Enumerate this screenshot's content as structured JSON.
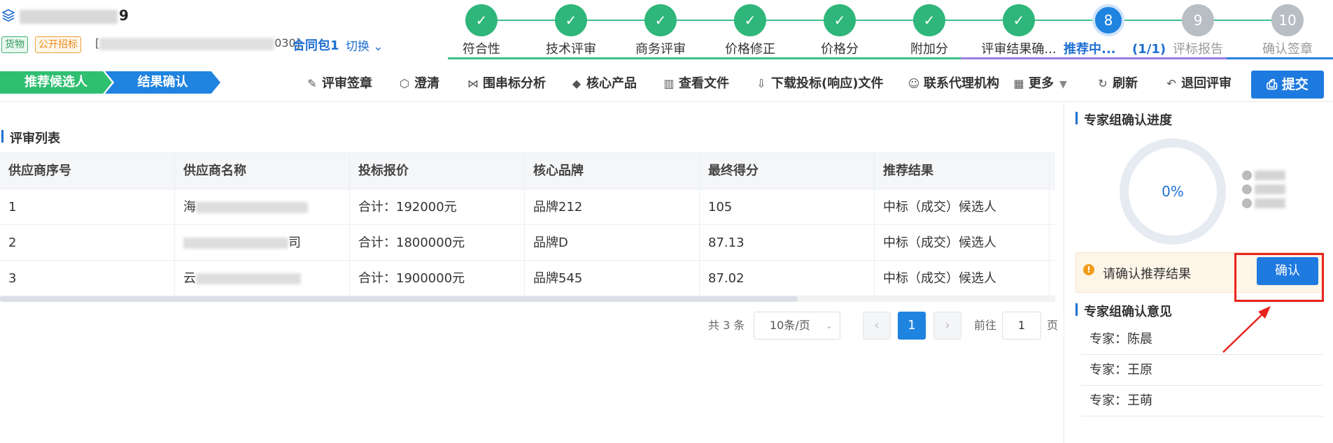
{
  "project": {
    "title_suffix": "9",
    "tag_goods": "货物",
    "tag_public": "公开招标",
    "code_prefix": "[",
    "code_suffix": "030]",
    "package": "合同包1",
    "switch_label": "切换"
  },
  "steps": [
    {
      "num": "✓",
      "label": "符合性",
      "state": "done"
    },
    {
      "num": "✓",
      "label": "技术评审",
      "state": "done"
    },
    {
      "num": "✓",
      "label": "商务评审",
      "state": "done"
    },
    {
      "num": "✓",
      "label": "价格修正",
      "state": "done"
    },
    {
      "num": "✓",
      "label": "价格分",
      "state": "done"
    },
    {
      "num": "✓",
      "label": "附加分",
      "state": "done"
    },
    {
      "num": "✓",
      "label": "评审结果确...",
      "state": "done"
    },
    {
      "num": "8",
      "label": "推荐中...",
      "state": "current",
      "count": "(1/1)"
    },
    {
      "num": "9",
      "label": "评标报告",
      "state": "todo"
    },
    {
      "num": "10",
      "label": "确认签章",
      "state": "todo"
    }
  ],
  "subflow": {
    "step1": "推荐候选人",
    "step2": "结果确认"
  },
  "toolbar": {
    "sign": "评审签章",
    "clarify": "澄清",
    "collusion": "围串标分析",
    "core_product": "核心产品",
    "view_files": "查看文件",
    "download": "下载投标(响应)文件",
    "contact_agency": "联系代理机构",
    "more": "更多",
    "refresh": "刷新",
    "return": "退回评审",
    "submit": "提交"
  },
  "review_list": {
    "title": "评审列表",
    "columns": [
      "供应商序号",
      "供应商名称",
      "投标报价",
      "核心品牌",
      "最终得分",
      "推荐结果"
    ],
    "rows": [
      {
        "no": "1",
        "name_prefix": "海",
        "name_suffix": "",
        "price": "合计：192000元",
        "brand": "品牌212",
        "score": "105",
        "result": "中标（成交）候选人"
      },
      {
        "no": "2",
        "name_prefix": "",
        "name_suffix": "司",
        "price": "合计：1800000元",
        "brand": "品牌D",
        "score": "87.13",
        "result": "中标（成交）候选人"
      },
      {
        "no": "3",
        "name_prefix": "云",
        "name_suffix": "",
        "price": "合计：1900000元",
        "brand": "品牌545",
        "score": "87.02",
        "result": "中标（成交）候选人"
      }
    ]
  },
  "pager": {
    "total": "共 3 条",
    "size": "10条/页",
    "prev": "‹",
    "current": "1",
    "next": "›",
    "goto": "前往",
    "input": "1",
    "unit": "页"
  },
  "progress": {
    "title": "专家组确认进度",
    "percent": "0%"
  },
  "alert": {
    "message": "请确认推荐结果",
    "confirm": "确认"
  },
  "opinions": {
    "title": "专家组确认意见",
    "experts": [
      "专家：陈晨",
      "专家：王原",
      "专家：王萌"
    ]
  }
}
